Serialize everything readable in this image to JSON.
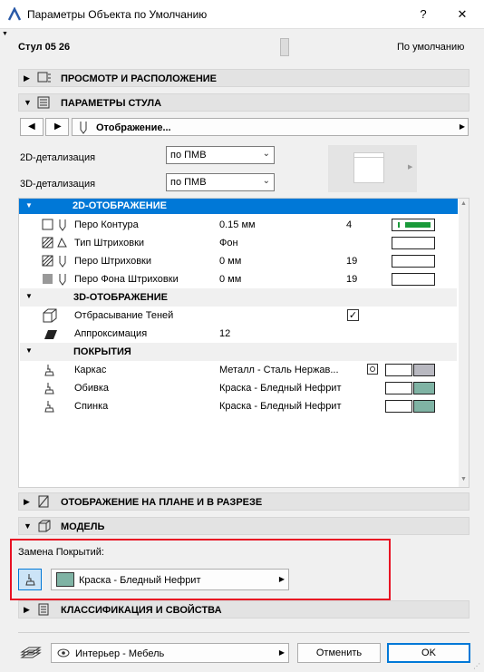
{
  "window": {
    "title": "Параметры Объекта по Умолчанию",
    "help": "?",
    "close": "✕"
  },
  "header": {
    "object_name": "Стул 05 26",
    "default_label": "По умолчанию"
  },
  "sections": {
    "view": "ПРОСМОТР И РАСПОЛОЖЕНИЕ",
    "chair": "ПАРАМЕТРЫ СТУЛА",
    "plan": "ОТОБРАЖЕНИЕ НА ПЛАНЕ И В РАЗРЕЗЕ",
    "model": "МОДЕЛЬ",
    "classification": "КЛАССИФИКАЦИЯ И СВОЙСТВА"
  },
  "toolbar": {
    "page_label": "Отображение..."
  },
  "detail": {
    "label_2d": "2D-детализация",
    "value_2d": "по ПМВ",
    "label_3d": "3D-детализация",
    "value_3d": "по ПМВ"
  },
  "table": {
    "group_2d": "2D-ОТОБРАЖЕНИЕ",
    "rows_2d": [
      {
        "name": "Перо Контура",
        "value": "0.15 мм",
        "num": "4"
      },
      {
        "name": "Тип Штриховки",
        "value": "Фон",
        "num": ""
      },
      {
        "name": "Перо Штриховки",
        "value": "0 мм",
        "num": "19"
      },
      {
        "name": "Перо Фона Штриховки",
        "value": "0 мм",
        "num": "19"
      }
    ],
    "group_3d": "3D-ОТОБРАЖЕНИЕ",
    "rows_3d": [
      {
        "name": "Отбрасывание Теней",
        "value": "",
        "num": "✓"
      },
      {
        "name": "Аппроксимация",
        "value": "12",
        "num": ""
      }
    ],
    "group_cov": "ПОКРЫТИЯ",
    "rows_cov": [
      {
        "name": "Каркас",
        "value": "Металл - Сталь Нержав..."
      },
      {
        "name": "Обивка",
        "value": "Краска - Бледный Нефрит"
      },
      {
        "name": "Спинка",
        "value": "Краска - Бледный Нефрит"
      }
    ]
  },
  "model": {
    "override_label": "Замена Покрытий:",
    "surface": "Краска - Бледный Нефрит"
  },
  "footer": {
    "favorite": "Интерьер - Мебель",
    "cancel": "Отменить",
    "ok": "OK"
  },
  "colors": {
    "accent": "#0078d7",
    "highlight": "#e81123",
    "jade": "#7fb3a4",
    "pen_green": "#1a9a3a",
    "metal": "#b8b8c0"
  }
}
